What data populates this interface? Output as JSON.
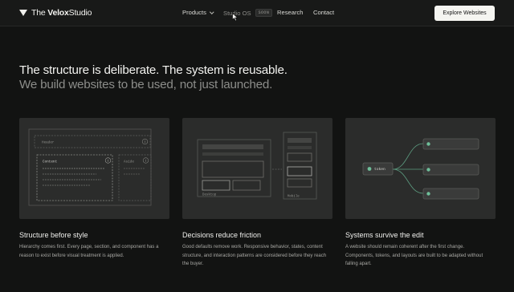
{
  "nav": {
    "logo_prefix": "The ",
    "logo_bold": "Velox",
    "logo_suffix": "Studio",
    "products": "Products",
    "studio_os": "Studio OS",
    "studio_badge": "SOON",
    "research": "Research",
    "contact": "Contact",
    "cta": "Explore Websites"
  },
  "hero": {
    "title": "The structure is deliberate. The system is reusable.",
    "subtitle": "We build websites to be used, not just launched."
  },
  "cards": {
    "structure": {
      "header": "Header",
      "content": "Content",
      "aside": "Aside"
    },
    "decisions": {
      "desktop": "Desktop",
      "mobile": "Mobile"
    },
    "systems": {
      "token": "token"
    }
  },
  "features": [
    {
      "title": "Structure before style",
      "desc": "Hierarchy comes first. Every page, section, and component has a reason to exist before visual treatment is applied."
    },
    {
      "title": "Decisions reduce friction",
      "desc": "Good defaults remove work. Responsive behavior, states, content structure, and interaction patterns are considered before they reach the buyer."
    },
    {
      "title": "Systems survive the edit",
      "desc": "A website should remain coherent after the first change. Components, tokens, and layouts are built to be adapted without falling apart."
    }
  ],
  "colors": {
    "accent": "#6fbf9a",
    "background": "#121312",
    "card": "#2b2c2b",
    "cta_bg": "#f5f5f1"
  },
  "icons": [
    "logo-triangle-icon",
    "chevron-down-icon",
    "cursor-icon",
    "info-icon",
    "token-dot-icon"
  ]
}
